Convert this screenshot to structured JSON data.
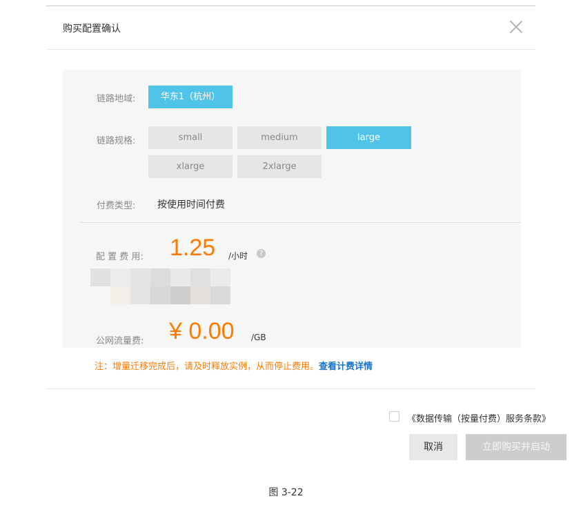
{
  "dialog": {
    "title": "购买配置确认"
  },
  "config": {
    "region_label": "链路地域:",
    "region_value": "华东1（杭州）",
    "spec_label": "链路规格:",
    "spec_options": [
      "small",
      "medium",
      "large",
      "xlarge",
      "2xlarge"
    ],
    "spec_selected": "large",
    "pay_label": "付费类型:",
    "pay_value": "按使用时间付费"
  },
  "fees": {
    "config_label": "配 置 费 用:",
    "config_amount": "1.25",
    "config_unit": "/小时",
    "help_symbol": "?",
    "traffic_label": "公网流量费:",
    "traffic_amount": "¥ 0.00",
    "traffic_unit": "/GB"
  },
  "note": {
    "text": "注：增量迁移完成后，请及时释放实例，从而停止费用。",
    "link": "查看计费详情"
  },
  "footer": {
    "agreement": "《数据传输（按量付费）服务条款》",
    "cancel_label": "取消",
    "buy_label": "立即购买并启动"
  },
  "caption": "图 3-22",
  "colors": {
    "accent": "#4fc3e8",
    "price": "#ff7a00",
    "link": "#1a75c8"
  }
}
